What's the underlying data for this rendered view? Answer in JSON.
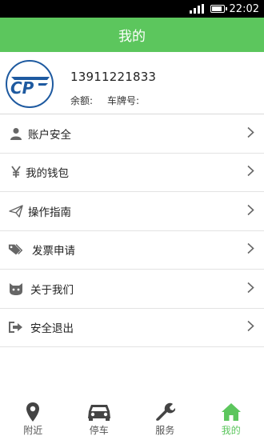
{
  "status_bar": {
    "time": "22:02"
  },
  "header": {
    "title": "我的"
  },
  "profile": {
    "phone": "13911221833",
    "balance_label": "余额:",
    "plate_label": "车牌号:"
  },
  "menu": {
    "items": [
      {
        "label": "账户安全",
        "icon": "user-icon"
      },
      {
        "label": "我的钱包",
        "icon": "yen-icon"
      },
      {
        "label": "操作指南",
        "icon": "send-icon"
      },
      {
        "label": "发票申请",
        "icon": "tags-icon"
      },
      {
        "label": "关于我们",
        "icon": "mascot-icon"
      },
      {
        "label": "安全退出",
        "icon": "logout-icon"
      }
    ]
  },
  "tabbar": {
    "tabs": [
      {
        "label": "附近",
        "icon": "map-marker-icon"
      },
      {
        "label": "停车",
        "icon": "car-icon"
      },
      {
        "label": "服务",
        "icon": "wrench-icon"
      },
      {
        "label": "我的",
        "icon": "home-icon",
        "active": true
      }
    ]
  },
  "colors": {
    "accent": "#5cc65d",
    "logo_blue": "#1e5aa0"
  }
}
